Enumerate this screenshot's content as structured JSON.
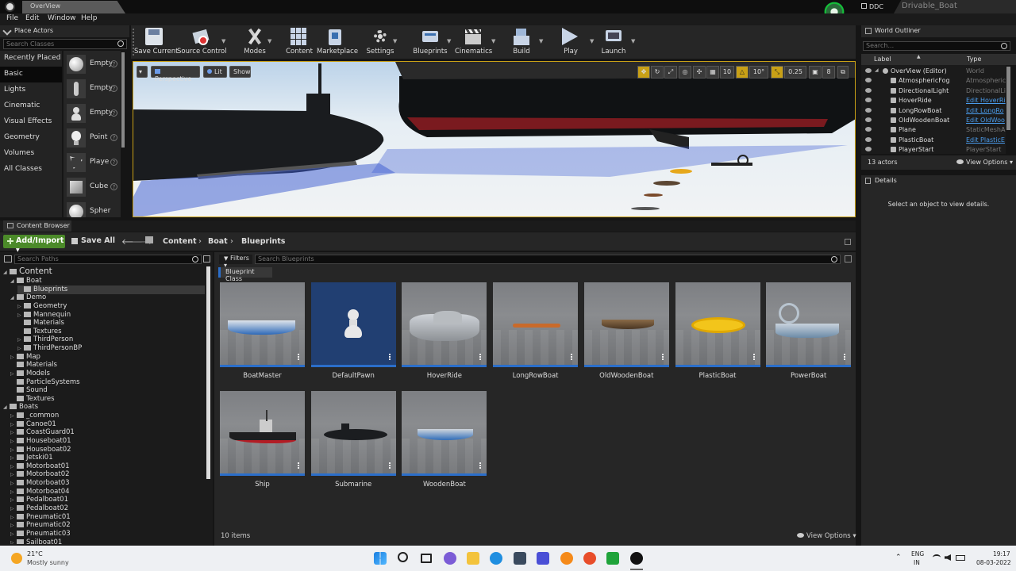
{
  "window": {
    "tab_title": "OverView",
    "project_tab": "Drivable_Boat",
    "ddc_label": "DDC"
  },
  "menu": [
    "File",
    "Edit",
    "Window",
    "Help"
  ],
  "place_actors": {
    "title": "Place Actors",
    "search_placeholder": "Search Classes",
    "categories": [
      "Recently Placed",
      "Basic",
      "Lights",
      "Cinematic",
      "Visual Effects",
      "Geometry",
      "Volumes",
      "All Classes"
    ],
    "active_category": "Basic",
    "items": [
      "Empty",
      "Empty",
      "Empty",
      "Point",
      "Playe",
      "Cube",
      "Spher"
    ]
  },
  "toolbar": [
    {
      "label": "Save Current",
      "icon": "save-icon"
    },
    {
      "label": "Source Control",
      "icon": "source-control-icon"
    },
    {
      "label": "Modes",
      "icon": "modes-icon"
    },
    {
      "label": "Content",
      "icon": "content-icon"
    },
    {
      "label": "Marketplace",
      "icon": "marketplace-icon"
    },
    {
      "label": "Settings",
      "icon": "settings-icon"
    },
    {
      "label": "Blueprints",
      "icon": "blueprints-icon"
    },
    {
      "label": "Cinematics",
      "icon": "cinematics-icon"
    },
    {
      "label": "Build",
      "icon": "build-icon"
    },
    {
      "label": "Play",
      "icon": "play-icon"
    },
    {
      "label": "Launch",
      "icon": "launch-icon"
    }
  ],
  "viewport": {
    "perspective": "Perspective",
    "lit": "Lit",
    "show": "Show",
    "grid_snap": "10",
    "rotation_snap": "10°",
    "scale_snap": "0.25",
    "camera_speed": "8"
  },
  "world_outliner": {
    "title": "World Outliner",
    "search_placeholder": "Search...",
    "col_label": "Label",
    "col_type": "Type",
    "rows": [
      {
        "label": "OverView (Editor)",
        "type": "World",
        "link": false
      },
      {
        "label": "AtmosphericFog",
        "type": "AtmosphericF",
        "link": false
      },
      {
        "label": "DirectionalLight",
        "type": "DirectionalLi",
        "link": false
      },
      {
        "label": "HoverRide",
        "type": "Edit HoverRi",
        "link": true
      },
      {
        "label": "LongRowBoat",
        "type": "Edit LongRo",
        "link": true
      },
      {
        "label": "OldWoodenBoat",
        "type": "Edit OldWoo",
        "link": true
      },
      {
        "label": "Plane",
        "type": "StaticMeshA",
        "link": false
      },
      {
        "label": "PlasticBoat",
        "type": "Edit PlasticE",
        "link": true
      },
      {
        "label": "PlayerStart",
        "type": "PlayerStart",
        "link": false
      }
    ],
    "actor_count": "13 actors",
    "view_options": "View Options"
  },
  "details": {
    "title": "Details",
    "empty_text": "Select an object to view details."
  },
  "content_browser": {
    "tab": "Content Browser",
    "add_import": "Add/Import",
    "save_all": "Save All",
    "breadcrumbs": [
      "Content",
      "Boat",
      "Blueprints"
    ],
    "path_search_placeholder": "Search Paths",
    "asset_search_placeholder": "Search Blueprints",
    "filters": "Filters",
    "filter_tag": "Blueprint Class",
    "tree": [
      {
        "label": "Content",
        "depth": 0,
        "arrow": "open",
        "big": true
      },
      {
        "label": "Boat",
        "depth": 1,
        "arrow": "open"
      },
      {
        "label": "Blueprints",
        "depth": 2,
        "arrow": "",
        "selected": true
      },
      {
        "label": "Demo",
        "depth": 1,
        "arrow": "open"
      },
      {
        "label": "Geometry",
        "depth": 2,
        "arrow": "closed"
      },
      {
        "label": "Mannequin",
        "depth": 2,
        "arrow": "closed"
      },
      {
        "label": "Materials",
        "depth": 2,
        "arrow": ""
      },
      {
        "label": "Textures",
        "depth": 2,
        "arrow": ""
      },
      {
        "label": "ThirdPerson",
        "depth": 2,
        "arrow": "closed"
      },
      {
        "label": "ThirdPersonBP",
        "depth": 2,
        "arrow": "closed"
      },
      {
        "label": "Map",
        "depth": 1,
        "arrow": "closed"
      },
      {
        "label": "Materials",
        "depth": 1,
        "arrow": ""
      },
      {
        "label": "Models",
        "depth": 1,
        "arrow": "closed"
      },
      {
        "label": "ParticleSystems",
        "depth": 1,
        "arrow": ""
      },
      {
        "label": "Sound",
        "depth": 1,
        "arrow": ""
      },
      {
        "label": "Textures",
        "depth": 1,
        "arrow": ""
      },
      {
        "label": "Boats",
        "depth": 0,
        "arrow": "open"
      },
      {
        "label": "_common",
        "depth": 1,
        "arrow": "closed"
      },
      {
        "label": "Canoe01",
        "depth": 1,
        "arrow": "closed"
      },
      {
        "label": "CoastGuard01",
        "depth": 1,
        "arrow": "closed"
      },
      {
        "label": "Houseboat01",
        "depth": 1,
        "arrow": "closed"
      },
      {
        "label": "Houseboat02",
        "depth": 1,
        "arrow": "closed"
      },
      {
        "label": "Jetski01",
        "depth": 1,
        "arrow": "closed"
      },
      {
        "label": "Motorboat01",
        "depth": 1,
        "arrow": "closed"
      },
      {
        "label": "Motorboat02",
        "depth": 1,
        "arrow": "closed"
      },
      {
        "label": "Motorboat03",
        "depth": 1,
        "arrow": "closed"
      },
      {
        "label": "Motorboat04",
        "depth": 1,
        "arrow": "closed"
      },
      {
        "label": "Pedalboat01",
        "depth": 1,
        "arrow": "closed"
      },
      {
        "label": "Pedalboat02",
        "depth": 1,
        "arrow": "closed"
      },
      {
        "label": "Pneumatic01",
        "depth": 1,
        "arrow": "closed"
      },
      {
        "label": "Pneumatic02",
        "depth": 1,
        "arrow": "closed"
      },
      {
        "label": "Pneumatic03",
        "depth": 1,
        "arrow": "closed"
      },
      {
        "label": "Sailboat01",
        "depth": 1,
        "arrow": "closed"
      }
    ],
    "assets": [
      {
        "name": "BoatMaster",
        "kind": "boat-blue"
      },
      {
        "name": "DefaultPawn",
        "kind": "pawn"
      },
      {
        "name": "HoverRide",
        "kind": "hover"
      },
      {
        "name": "LongRowBoat",
        "kind": "long"
      },
      {
        "name": "OldWoodenBoat",
        "kind": "wooden"
      },
      {
        "name": "PlasticBoat",
        "kind": "plastic"
      },
      {
        "name": "PowerBoat",
        "kind": "power"
      },
      {
        "name": "Ship",
        "kind": "ship"
      },
      {
        "name": "Submarine",
        "kind": "sub"
      },
      {
        "name": "WoodenBoat",
        "kind": "woodenblue"
      }
    ],
    "item_count": "10 items",
    "view_options": "View Options"
  },
  "taskbar": {
    "temp": "21°C",
    "weather": "Mostly sunny",
    "lang1": "ENG",
    "lang2": "IN",
    "time": "19:17",
    "date": "08-03-2022"
  }
}
